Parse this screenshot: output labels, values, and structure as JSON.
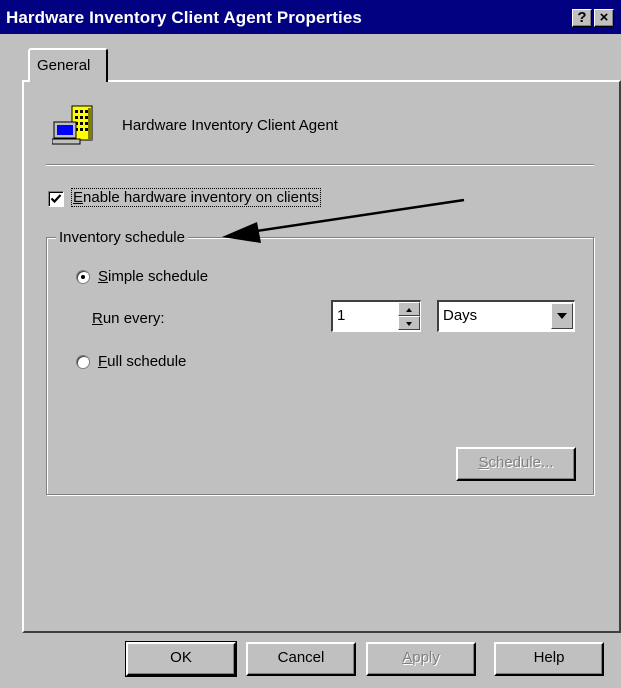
{
  "window": {
    "title": "Hardware Inventory Client Agent Properties",
    "help_button": "?",
    "close_button": "×"
  },
  "tabs": [
    {
      "label": "General",
      "selected": true
    }
  ],
  "general": {
    "agent_name": "Hardware Inventory Client Agent",
    "enable_checkbox": {
      "label_access": "E",
      "label_rest": "nable hardware inventory on clients",
      "checked": true
    },
    "schedule_group": {
      "legend": "Inventory schedule",
      "simple": {
        "access": "S",
        "rest": "imple schedule",
        "selected": true
      },
      "run_every": {
        "access": "R",
        "rest": "un every:",
        "value": "1",
        "unit": "Days"
      },
      "full": {
        "access": "F",
        "rest": "ull schedule",
        "selected": false
      },
      "schedule_button": {
        "access": "S",
        "rest": "chedule...",
        "enabled": false
      }
    }
  },
  "buttons": {
    "ok": "OK",
    "cancel": "Cancel",
    "apply": {
      "access": "A",
      "rest": "pply",
      "enabled": false
    },
    "help": "Help"
  },
  "colors": {
    "titlebar": "#000080",
    "face": "#c0c0c0"
  }
}
